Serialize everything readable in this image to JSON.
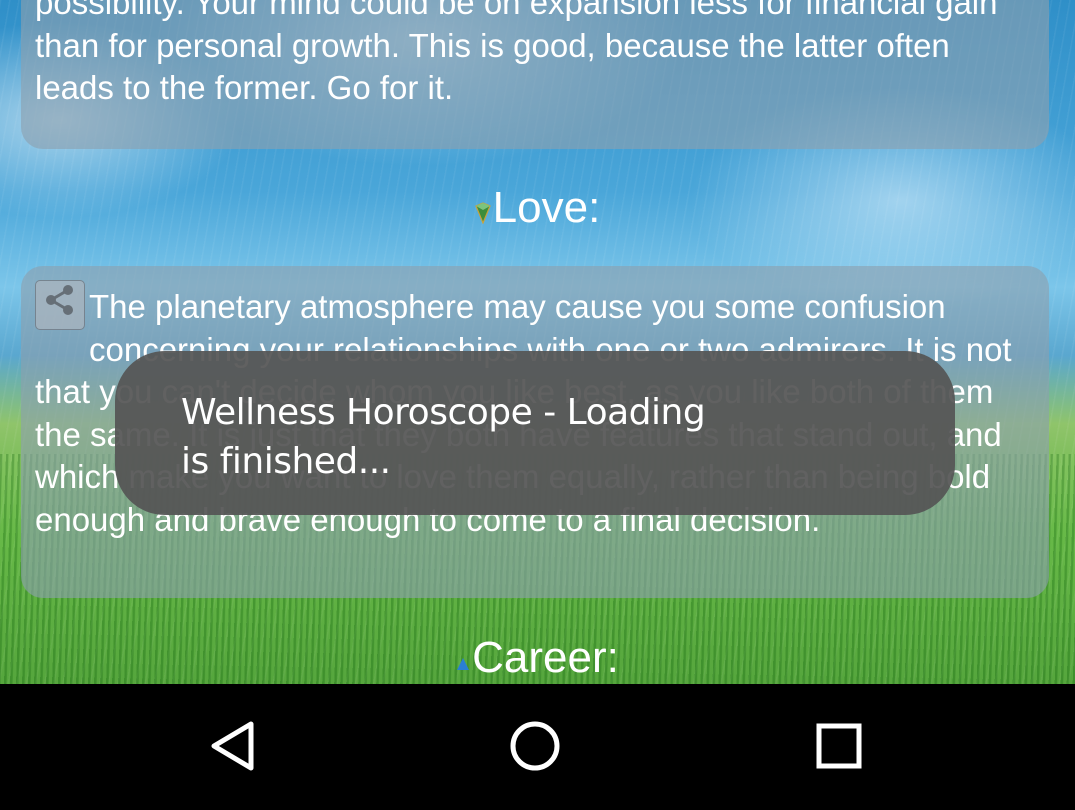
{
  "finance": {
    "text": "possibility. Your mind could be on expansion less for financial gain than for personal growth. This is good, because the latter often leads to the former. Go for it."
  },
  "love": {
    "heading": "Love:",
    "gem_color": "#3a8a3a",
    "text": "The planetary atmosphere may cause you some confusion concerning your relationships with one or two admirers. It is not that you can't decide whom you like best, as you like both of them the same. It is just that they both have features that stand out, and which make you want to love them equally, rather than being bold enough and brave enough to come to a final decision.",
    "share_icon": "share-icon"
  },
  "career": {
    "heading": "Career:",
    "gem_color": "#2a7fd4"
  },
  "toast": {
    "message": "Wellness Horoscope - Loading is finished..."
  },
  "navbar": {
    "back_icon": "back-triangle-icon",
    "home_icon": "home-circle-icon",
    "recents_icon": "recents-square-icon"
  }
}
